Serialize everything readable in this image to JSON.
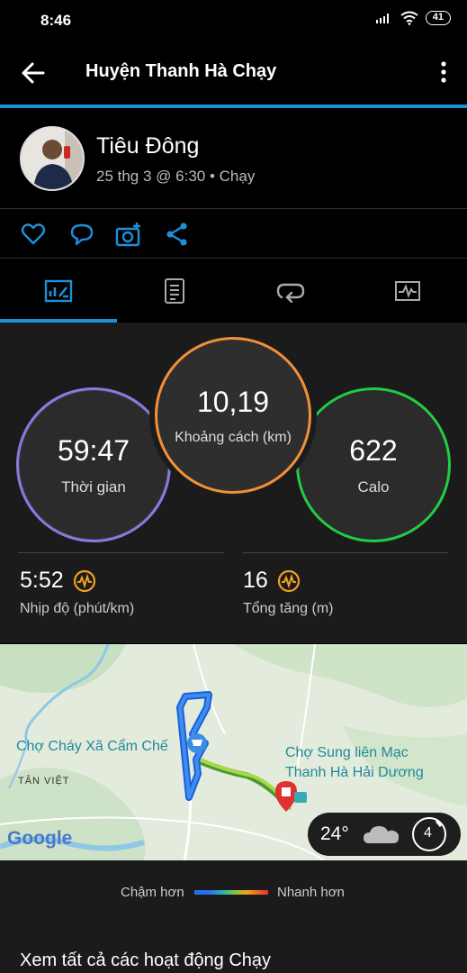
{
  "status_bar": {
    "time": "8:46",
    "battery": "41"
  },
  "app_bar": {
    "title": "Huyện Thanh Hà Chạy"
  },
  "profile": {
    "name": "Tiêu Đông",
    "meta": "25 thg 3 @ 6:30 • Chạy"
  },
  "actions": [
    "heart-icon",
    "comment-icon",
    "add-photo-icon",
    "share-icon"
  ],
  "tabs": [
    {
      "icon": "stats-icon",
      "selected": true
    },
    {
      "icon": "details-icon",
      "selected": false
    },
    {
      "icon": "laps-icon",
      "selected": false
    },
    {
      "icon": "charts-icon",
      "selected": false
    }
  ],
  "stats": {
    "time": {
      "value": "59:47",
      "label": "Thời gian",
      "color": "#8a7ae0"
    },
    "distance": {
      "value": "10,19",
      "label": "Khoảng cách (km)",
      "color": "#f0903a"
    },
    "calories": {
      "value": "622",
      "label": "Calo",
      "color": "#22cc44"
    },
    "pace": {
      "value": "5:52",
      "label": "Nhịp độ (phút/km)"
    },
    "elevation": {
      "value": "16",
      "label": "Tổng tăng (m)"
    }
  },
  "map": {
    "label_market1": "Chợ Cháy Xã Cẩm Chế",
    "label_market2_line1": "Chợ Sung liên Mạc",
    "label_market2_line2": "Thanh Hà Hải Dương",
    "label_village": "TÂN VIỆT",
    "logo": "Google",
    "weather": {
      "temp": "24°",
      "wind": "4"
    }
  },
  "legend": {
    "slow": "Chậm hơn",
    "fast": "Nhanh hơn"
  },
  "see_all": "Xem tất cả các hoạt động Chạy",
  "colors": {
    "accent": "#1e90d8",
    "orange": "#f0903a"
  }
}
